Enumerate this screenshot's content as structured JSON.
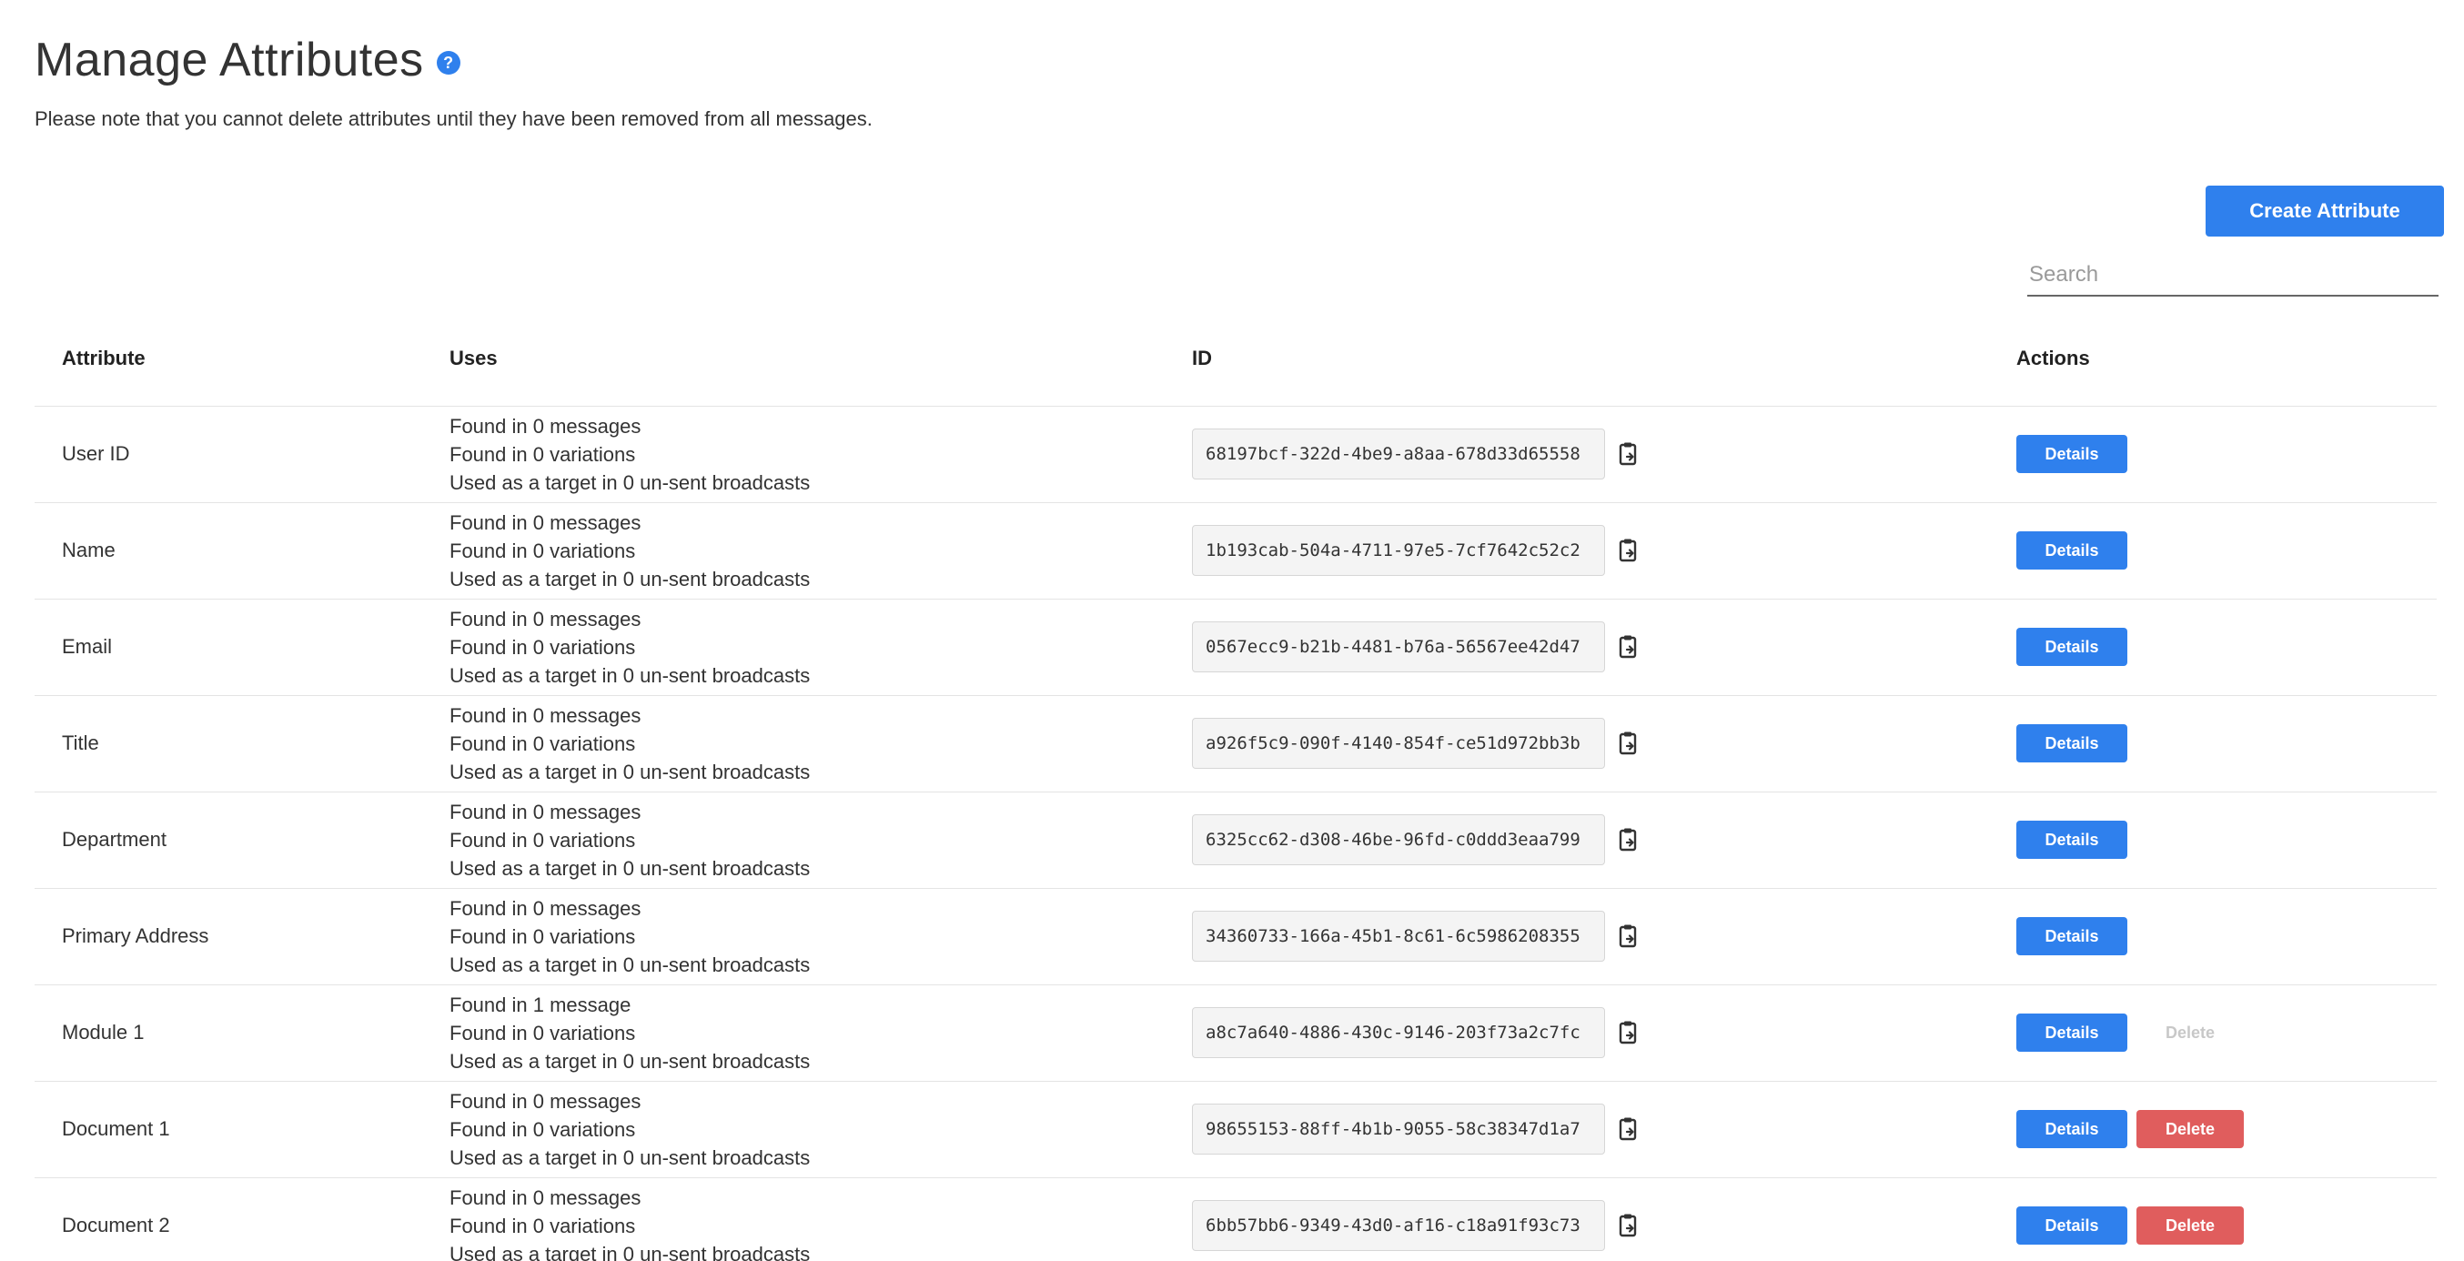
{
  "header": {
    "title": "Manage Attributes",
    "help_glyph": "?",
    "note": "Please note that you cannot delete attributes until they have been removed from all messages."
  },
  "toolbar": {
    "create_label": "Create Attribute",
    "search_placeholder": "Search"
  },
  "table": {
    "columns": [
      "Attribute",
      "Uses",
      "ID",
      "Actions"
    ],
    "rows": [
      {
        "attribute": "User ID",
        "uses": [
          "Found in 0 messages",
          "Found in 0 variations",
          "Used as a target in 0 un-sent broadcasts"
        ],
        "id": "68197bcf-322d-4be9-a8aa-678d33d65558",
        "details": "Details",
        "delete": null
      },
      {
        "attribute": "Name",
        "uses": [
          "Found in 0 messages",
          "Found in 0 variations",
          "Used as a target in 0 un-sent broadcasts"
        ],
        "id": "1b193cab-504a-4711-97e5-7cf7642c52c2",
        "details": "Details",
        "delete": null
      },
      {
        "attribute": "Email",
        "uses": [
          "Found in 0 messages",
          "Found in 0 variations",
          "Used as a target in 0 un-sent broadcasts"
        ],
        "id": "0567ecc9-b21b-4481-b76a-56567ee42d47",
        "details": "Details",
        "delete": null
      },
      {
        "attribute": "Title",
        "uses": [
          "Found in 0 messages",
          "Found in 0 variations",
          "Used as a target in 0 un-sent broadcasts"
        ],
        "id": "a926f5c9-090f-4140-854f-ce51d972bb3b",
        "details": "Details",
        "delete": null
      },
      {
        "attribute": "Department",
        "uses": [
          "Found in 0 messages",
          "Found in 0 variations",
          "Used as a target in 0 un-sent broadcasts"
        ],
        "id": "6325cc62-d308-46be-96fd-c0ddd3eaa799",
        "details": "Details",
        "delete": null
      },
      {
        "attribute": "Primary Address",
        "uses": [
          "Found in 0 messages",
          "Found in 0 variations",
          "Used as a target in 0 un-sent broadcasts"
        ],
        "id": "34360733-166a-45b1-8c61-6c5986208355",
        "details": "Details",
        "delete": null
      },
      {
        "attribute": "Module 1",
        "uses": [
          "Found in 1 message",
          "Found in 0 variations",
          "Used as a target in 0 un-sent broadcasts"
        ],
        "id": "a8c7a640-4886-430c-9146-203f73a2c7fc",
        "details": "Details",
        "delete": "Delete",
        "delete_enabled": false
      },
      {
        "attribute": "Document 1",
        "uses": [
          "Found in 0 messages",
          "Found in 0 variations",
          "Used as a target in 0 un-sent broadcasts"
        ],
        "id": "98655153-88ff-4b1b-9055-58c38347d1a7",
        "details": "Details",
        "delete": "Delete",
        "delete_enabled": true
      },
      {
        "attribute": "Document 2",
        "uses": [
          "Found in 0 messages",
          "Found in 0 variations",
          "Used as a target in 0 un-sent broadcasts"
        ],
        "id": "6bb57bb6-9349-43d0-af16-c18a91f93c73",
        "details": "Details",
        "delete": "Delete",
        "delete_enabled": true
      }
    ]
  },
  "icons": {
    "help": "question-circle-icon",
    "copy": "clipboard-copy-icon"
  },
  "colors": {
    "primary": "#2f80ed",
    "danger": "#e05d5d",
    "disabled": "#c8c8c8"
  }
}
